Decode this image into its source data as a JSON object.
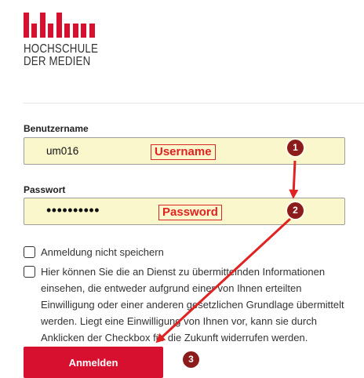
{
  "logo": {
    "line1": "HOCHSCHULE",
    "line2": "DER MEDIEN",
    "brand_color": "#d8102f"
  },
  "form": {
    "username_label": "Benutzername",
    "username_value": "um016",
    "password_label": "Passwort",
    "password_value": "••••••••••",
    "input_background": "#fbf7cc",
    "no_save_label": "Anmeldung nicht speichern",
    "consent_text": "Hier können Sie die an Dienst zu übermittelnden Informationen einsehen, die entweder aufgrund einer von Ihnen erteilten Einwilligung oder einer anderen gesetzlichen Grundlage übermittelt werden. Liegt eine Einwilligung von Ihnen vor, kann sie durch Anklicken der Checkbox für die Zukunft widerrufen werden.",
    "submit_label": "Anmelden"
  },
  "annotations": {
    "username_tag": "Username",
    "password_tag": "Password",
    "step1": "1",
    "step2": "2",
    "step3": "3",
    "color": "#d92828"
  }
}
